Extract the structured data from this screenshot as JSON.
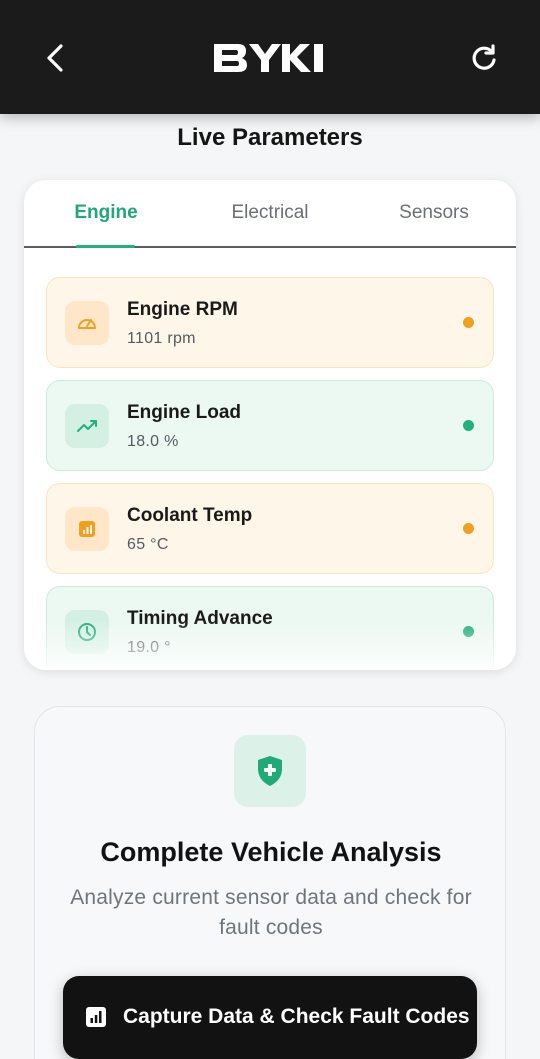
{
  "header": {
    "brand": "BYKI",
    "back_icon": "chevron-left-icon",
    "refresh_icon": "refresh-icon"
  },
  "page": {
    "title": "Live Parameters"
  },
  "tabs": [
    {
      "label": "Engine",
      "active": true
    },
    {
      "label": "Electrical",
      "active": false
    },
    {
      "label": "Sensors",
      "active": false
    }
  ],
  "parameters": [
    {
      "name": "Engine RPM",
      "value": "1101 rpm",
      "status": "warning",
      "icon": "gauge-icon"
    },
    {
      "name": "Engine Load",
      "value": "18.0 %",
      "status": "normal",
      "icon": "trending-up-icon"
    },
    {
      "name": "Coolant Temp",
      "value": "65 °C",
      "status": "warning",
      "icon": "bar-chart-icon"
    },
    {
      "name": "Timing Advance",
      "value": "19.0 °",
      "status": "normal",
      "icon": "clock-icon"
    }
  ],
  "analysis": {
    "icon": "shield-plus-icon",
    "title": "Complete Vehicle Analysis",
    "description": "Analyze current sensor data and check for fault codes"
  },
  "action_button": {
    "label": "Capture Data & Check Fault Codes",
    "icon": "bar-chart-icon"
  },
  "colors": {
    "accent_green": "#22b07e",
    "warning_orange": "#f0a01e",
    "header_bg": "#1b1b1b"
  }
}
